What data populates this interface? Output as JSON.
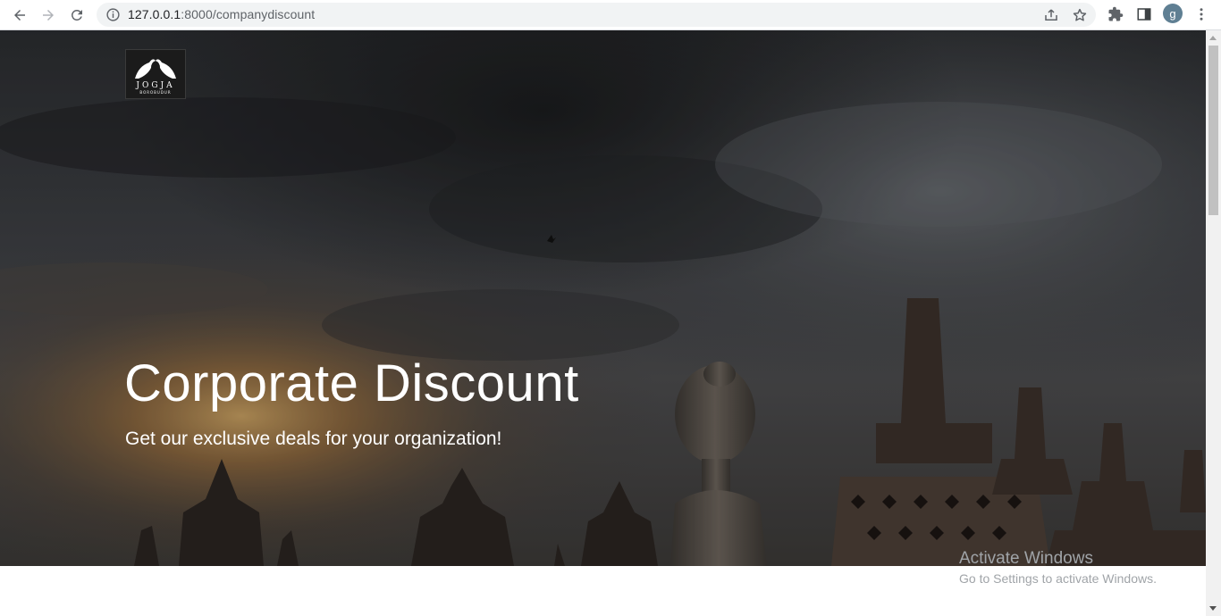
{
  "browser": {
    "url_host": "127.0.0.1",
    "url_path": ":8000/companydiscount",
    "profile_initial": "g",
    "icons": [
      "back-arrow-icon",
      "forward-arrow-icon",
      "reload-icon",
      "info-icon",
      "share-icon",
      "bookmark-star-icon",
      "extensions-puzzle-icon",
      "side-panel-icon",
      "kebab-menu-icon"
    ]
  },
  "hero": {
    "title": "Corporate Discount",
    "subtitle": "Get our exclusive deals for your organization!",
    "logo_text": "JOGJA",
    "logo_subtext": "BOROBUDUR"
  },
  "windows_watermark": {
    "line1": "Activate Windows",
    "line2": "Go to Settings to activate Windows."
  }
}
